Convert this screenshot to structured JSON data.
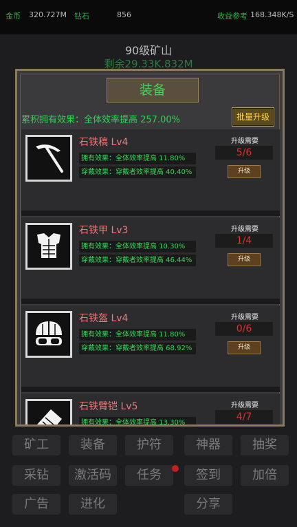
{
  "topbar": {
    "gold_label": "金币",
    "gold_value": "320.727M",
    "diamond_label": "钻石",
    "diamond_value": "856",
    "income_label": "收益参考",
    "income_value": "168.348K/S"
  },
  "background": {
    "mine_title": "90级矿山",
    "remaining": "剩余29.33K.832M"
  },
  "modal": {
    "title": "装备",
    "summary": "累积拥有效果：全体效率提高 257.00%",
    "batch_button": "批量升级",
    "items": [
      {
        "name": "石铁稿 Lv4",
        "icon": "pickaxe-icon",
        "own": "拥有效果：全体效率提高 11.80%",
        "wear": "穿戴效果：穿戴者效率提高 40.40%",
        "req_label": "升级需要",
        "req": "5/6",
        "upgrade": "升级"
      },
      {
        "name": "石铁甲 Lv3",
        "icon": "armor-icon",
        "own": "拥有效果：全体效率提高 10.30%",
        "wear": "穿戴效果：穿戴者效率提高 46.44%",
        "req_label": "升级需要",
        "req": "1/4",
        "upgrade": "升级"
      },
      {
        "name": "石铁盔 Lv4",
        "icon": "helmet-icon",
        "own": "拥有效果：全体效率提高 11.80%",
        "wear": "穿戴效果：穿戴者效率提高 68.92%",
        "req_label": "升级需要",
        "req": "0/6",
        "upgrade": "升级"
      },
      {
        "name": "石铁臂铠 Lv5",
        "icon": "bracer-icon",
        "own": "拥有效果：全体效率提高 13.30%",
        "wear": "",
        "req_label": "升级需要",
        "req": "4/7",
        "upgrade": ""
      }
    ]
  },
  "menu": {
    "row1": [
      "矿工",
      "装备",
      "护符",
      "神器",
      "抽奖"
    ],
    "row2": [
      "采钻",
      "激活码",
      "任务",
      "签到",
      "加倍"
    ],
    "row3": [
      "广告",
      "进化",
      "分享"
    ]
  },
  "colors": {
    "accent_green": "#3ed25a",
    "requirement_red": "#e03030",
    "item_name_pink": "#e97b7b",
    "frame_gold": "#8c7a5c"
  }
}
